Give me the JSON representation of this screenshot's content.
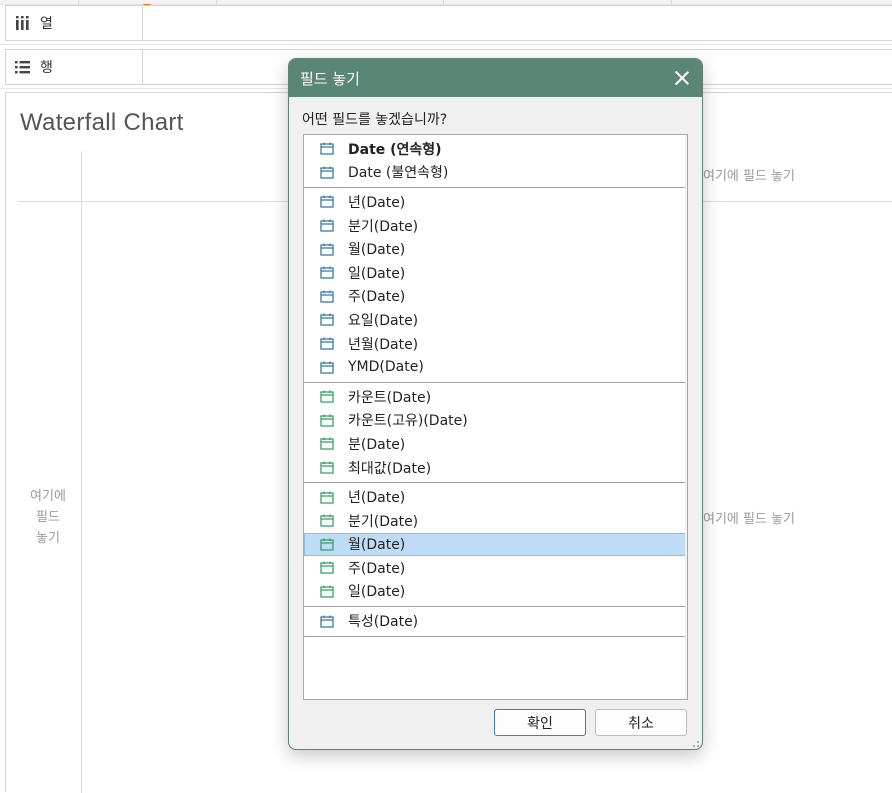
{
  "shelves": {
    "columns_label": "열",
    "rows_label": "행"
  },
  "sheet": {
    "title": "Waterfall Chart",
    "drop_hint_right": "여기에 필드 놓기",
    "drop_hint_left_lines": [
      "여기에",
      "필드",
      "놓기"
    ]
  },
  "dialog": {
    "title": "필드 놓기",
    "question": "어떤 필드를 놓겠습니까?",
    "groups": [
      {
        "icon_color": "#3a7ca5",
        "items": [
          {
            "label": "Date (연속형)",
            "bold": true,
            "selected": false
          },
          {
            "label": "Date (불연속형)",
            "bold": false,
            "selected": false
          }
        ]
      },
      {
        "icon_color": "#3a7ca5",
        "items": [
          {
            "label": "년(Date)",
            "bold": false,
            "selected": false
          },
          {
            "label": "분기(Date)",
            "bold": false,
            "selected": false
          },
          {
            "label": "월(Date)",
            "bold": false,
            "selected": false
          },
          {
            "label": "일(Date)",
            "bold": false,
            "selected": false
          },
          {
            "label": "주(Date)",
            "bold": false,
            "selected": false
          },
          {
            "label": "요일(Date)",
            "bold": false,
            "selected": false
          },
          {
            "label": "년월(Date)",
            "bold": false,
            "selected": false
          },
          {
            "label": "YMD(Date)",
            "bold": false,
            "selected": false
          }
        ]
      },
      {
        "icon_color": "#3aa06a",
        "items": [
          {
            "label": "카운트(Date)",
            "bold": false,
            "selected": false
          },
          {
            "label": "카운트(고유)(Date)",
            "bold": false,
            "selected": false
          },
          {
            "label": "분(Date)",
            "bold": false,
            "selected": false
          },
          {
            "label": "최대값(Date)",
            "bold": false,
            "selected": false
          }
        ]
      },
      {
        "icon_color": "#3aa06a",
        "items": [
          {
            "label": "년(Date)",
            "bold": false,
            "selected": false
          },
          {
            "label": "분기(Date)",
            "bold": false,
            "selected": false
          },
          {
            "label": "월(Date)",
            "bold": false,
            "selected": true
          },
          {
            "label": "주(Date)",
            "bold": false,
            "selected": false
          },
          {
            "label": "일(Date)",
            "bold": false,
            "selected": false
          }
        ]
      },
      {
        "icon_color": "#3a7ca5",
        "items": [
          {
            "label": "특성(Date)",
            "bold": false,
            "selected": false
          }
        ]
      }
    ],
    "ok_label": "확인",
    "cancel_label": "취소"
  },
  "colors": {
    "accent_titlebar": "#5a8676",
    "selection": "#bfdcf7",
    "discrete_blue": "#3a7ca5",
    "continuous_green": "#3aa06a",
    "marker_orange": "#e8762d"
  }
}
